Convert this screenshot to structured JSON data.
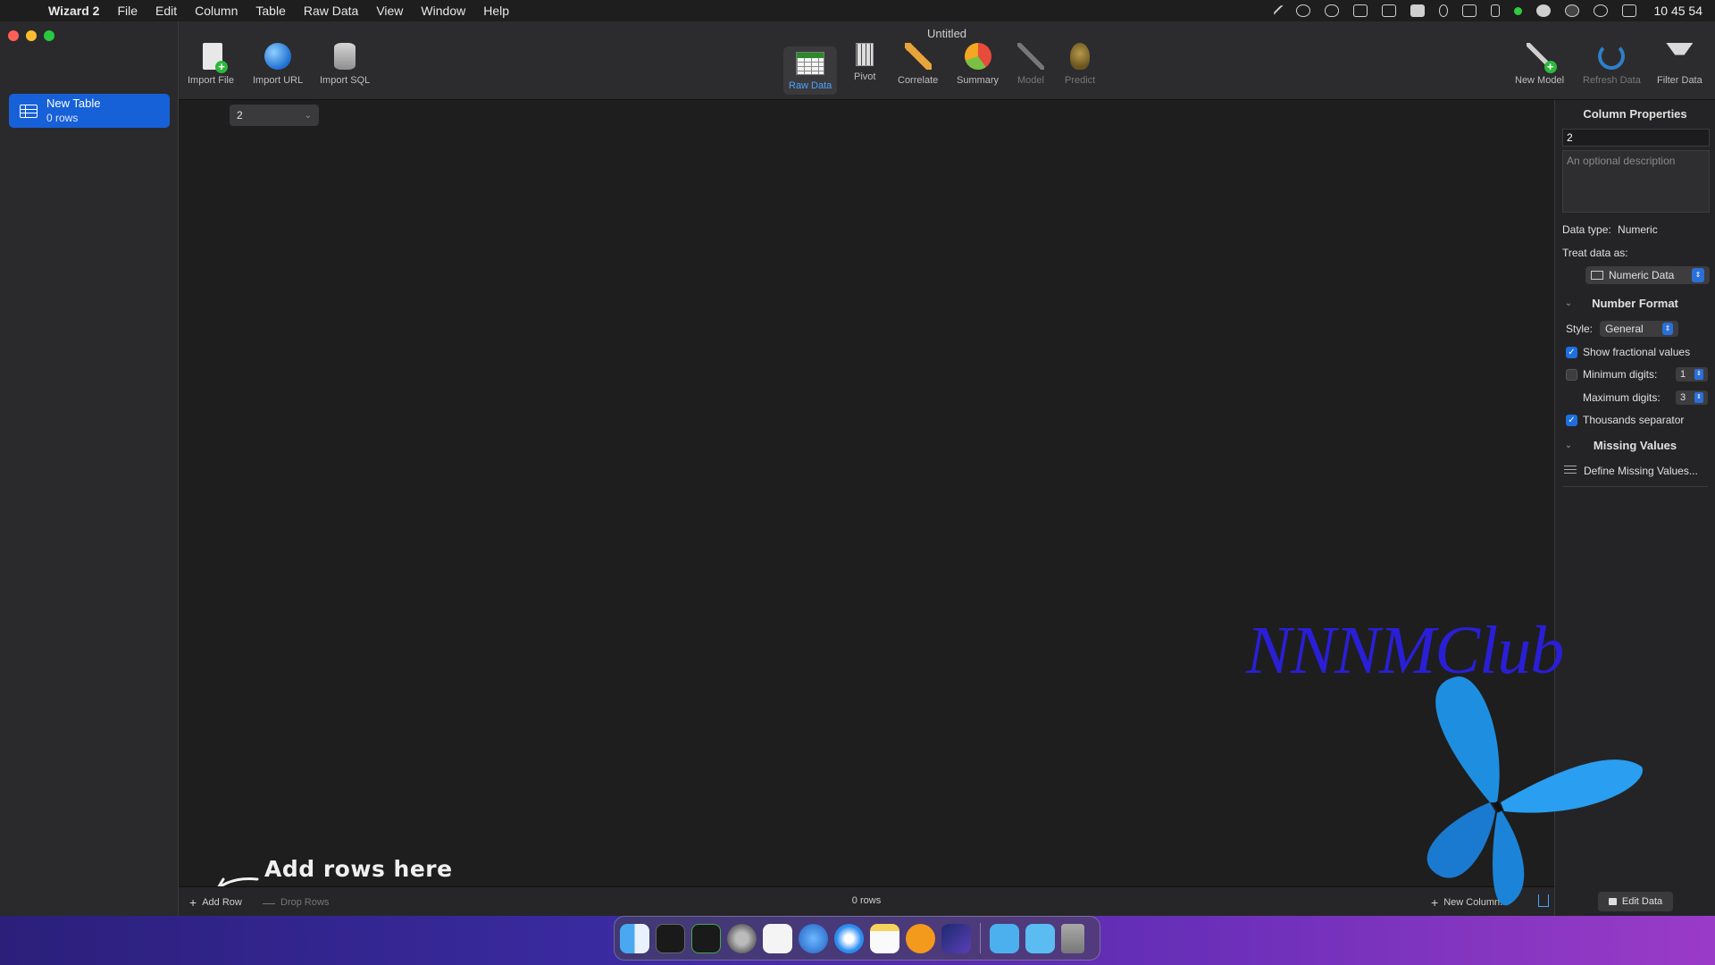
{
  "menubar": {
    "app_name": "Wizard 2",
    "items": [
      "File",
      "Edit",
      "Column",
      "Table",
      "Raw Data",
      "View",
      "Window",
      "Help"
    ],
    "clock": "10 45 54"
  },
  "window": {
    "title": "Untitled"
  },
  "sidebar": {
    "table_name": "New Table",
    "table_rows": "0 rows"
  },
  "toolbar": {
    "import_file": "Import File",
    "import_url": "Import URL",
    "import_sql": "Import SQL",
    "raw_data": "Raw Data",
    "pivot": "Pivot",
    "correlate": "Correlate",
    "summary": "Summary",
    "model": "Model",
    "predict": "Predict",
    "new_model": "New Model",
    "refresh_data": "Refresh Data",
    "filter_data": "Filter Data"
  },
  "main": {
    "column_selector": "2",
    "hint": "Add rows here"
  },
  "footer": {
    "add_row": "Add Row",
    "drop_rows": "Drop Rows",
    "row_count": "0 rows",
    "new_column": "New Column..."
  },
  "column_properties": {
    "title": "Column Properties",
    "name_value": "2",
    "description_placeholder": "An optional description",
    "data_type_label": "Data type:",
    "data_type_value": "Numeric",
    "treat_as_label": "Treat data as:",
    "treat_as_value": "Numeric Data",
    "number_format_title": "Number Format",
    "style_label": "Style:",
    "style_value": "General",
    "show_fractional_label": "Show fractional values",
    "show_fractional_checked": true,
    "min_digits_label": "Minimum digits:",
    "min_digits_value": "1",
    "min_digits_checked": false,
    "max_digits_label": "Maximum digits:",
    "max_digits_value": "3",
    "thousands_label": "Thousands separator",
    "thousands_checked": true,
    "missing_values_title": "Missing Values",
    "define_missing_label": "Define Missing Values...",
    "edit_data_label": "Edit Data"
  },
  "watermark": {
    "text": "NNNMClub"
  },
  "dock": {
    "apps": [
      "finder-icon",
      "terminal-icon",
      "activity-monitor-icon",
      "system-settings-icon",
      "textedit-icon",
      "network-icon",
      "safari-icon",
      "notes-icon",
      "anaconda-icon",
      "xcode-icon",
      "downloads-folder-icon",
      "applications-folder-icon",
      "trash-icon"
    ]
  },
  "colors": {
    "accent": "#1761d8",
    "desktop_left": "#2b1f7a",
    "desktop_right": "#9a3bc8"
  }
}
